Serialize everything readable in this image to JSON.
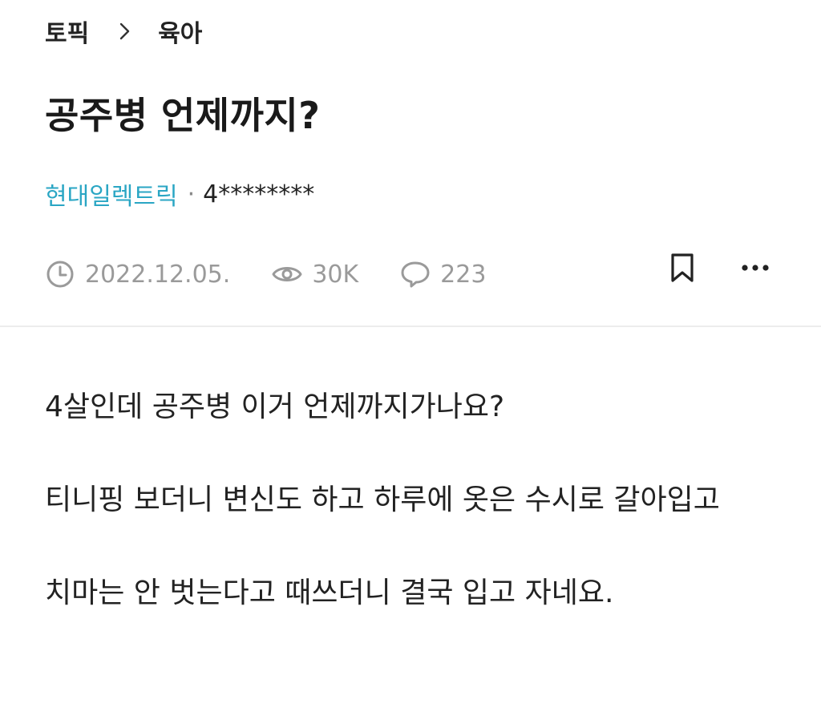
{
  "breadcrumb": {
    "items": [
      "토픽",
      "육아"
    ]
  },
  "post": {
    "title": "공주병 언제까지?",
    "company": "현대일렉트릭",
    "separator": "·",
    "user": "4********",
    "date": "2022.12.05.",
    "views": "30K",
    "comments": "223",
    "paragraphs": [
      "4살인데 공주병 이거 언제까지가나요?",
      "티니핑 보더니 변신도 하고 하루에 옷은 수시로 갈아입고",
      "치마는 안 벗는다고 때쓰더니 결국 입고 자네요."
    ]
  },
  "icons": {
    "breadcrumb_separator": "chevron-right-icon",
    "date": "clock-icon",
    "views": "eye-icon",
    "comments": "speech-bubble-icon",
    "bookmark": "bookmark-icon",
    "more": "more-horizontal-icon"
  },
  "colors": {
    "company": "#2aa6c4",
    "meta": "#9a9a9a",
    "text": "#222222",
    "divider": "#ececec"
  }
}
